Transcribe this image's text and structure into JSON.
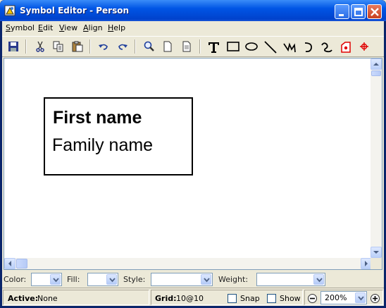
{
  "window": {
    "title": "Symbol Editor - Person"
  },
  "menubar": {
    "items": [
      {
        "label": "Symbol",
        "mnemonic": "S",
        "rest": "ymbol"
      },
      {
        "label": "Edit",
        "mnemonic": "E",
        "rest": "dit"
      },
      {
        "label": "View",
        "mnemonic": "V",
        "rest": "iew"
      },
      {
        "label": "Align",
        "mnemonic": "A",
        "rest": "lign"
      },
      {
        "label": "Help",
        "mnemonic": "H",
        "rest": "elp"
      }
    ]
  },
  "toolbar": {
    "icons": [
      "save-icon",
      "cut-icon",
      "copy-icon",
      "paste-icon",
      "undo-icon",
      "redo-icon",
      "zoom-icon",
      "page-icon",
      "page-properties-icon",
      "text-tool-icon",
      "rectangle-tool-icon",
      "ellipse-tool-icon",
      "line-tool-icon",
      "polyline-tool-icon",
      "arc-tool-icon",
      "curve-tool-icon",
      "port-tool-icon",
      "crosshair-tool-icon"
    ]
  },
  "canvas": {
    "symbol": {
      "first_line": "First name",
      "second_line": "Family name"
    }
  },
  "properties": {
    "color_label": "Color:",
    "fill_label": "Fill:",
    "style_label": "Style:",
    "weight_label": "Weight:",
    "color_value": "",
    "fill_value": "",
    "style_value": "",
    "weight_value": ""
  },
  "status": {
    "active_label": "Active:",
    "active_value": "None",
    "grid_label": "Grid:",
    "grid_value": "10@10",
    "snap_label": "Snap",
    "show_label": "Show",
    "zoom_value": "200%"
  },
  "colors": {
    "titlebar": "#0055E5",
    "client": "#ECE9D8",
    "red_tool": "#E00000"
  }
}
